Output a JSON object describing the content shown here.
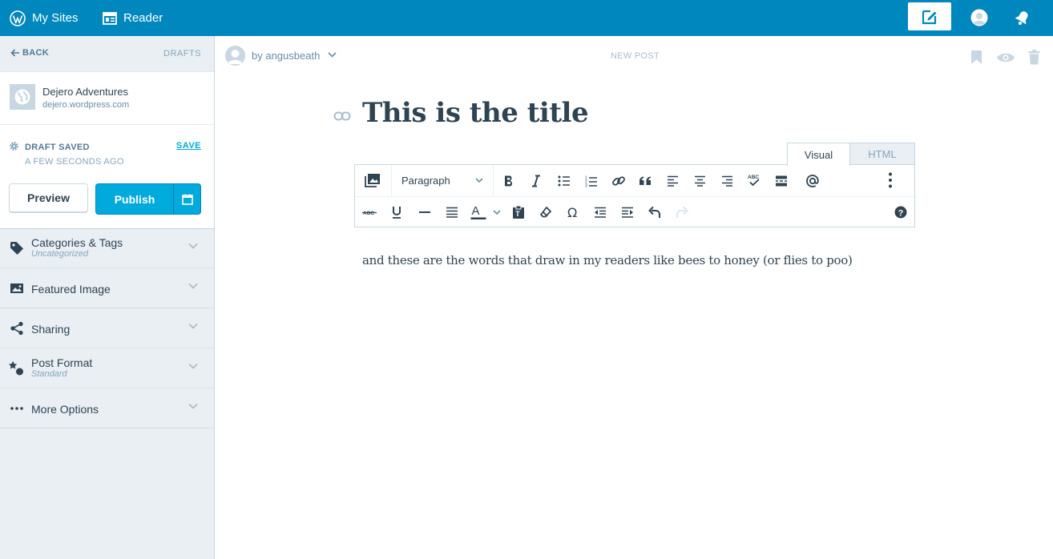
{
  "masterbar": {
    "my_sites": "My Sites",
    "reader": "Reader",
    "icons": [
      "wordpress-logo-icon",
      "reader-icon",
      "write-post-icon",
      "avatar-icon",
      "notifications-icon"
    ]
  },
  "sidebar": {
    "back": "BACK",
    "drafts": "DRAFTS",
    "site": {
      "title": "Dejero Adventures",
      "url": "dejero.wordpress.com"
    },
    "status": {
      "draft_saved": "DRAFT SAVED",
      "save": "SAVE",
      "time_ago": "A FEW SECONDS AGO"
    },
    "buttons": {
      "preview": "Preview",
      "publish": "Publish"
    },
    "accordions": [
      {
        "title": "Categories & Tags",
        "subtitle": "Uncategorized",
        "icon": "tag-icon"
      },
      {
        "title": "Featured Image",
        "subtitle": "",
        "icon": "image-icon"
      },
      {
        "title": "Sharing",
        "subtitle": "",
        "icon": "share-icon"
      },
      {
        "title": "Post Format",
        "subtitle": "Standard",
        "icon": "post-format-icon"
      },
      {
        "title": "More Options",
        "subtitle": "",
        "icon": "ellipsis-icon"
      }
    ]
  },
  "editor": {
    "author": "by angusbeath",
    "status_label": "NEW POST",
    "title": "This is the title",
    "tabs": {
      "visual": "Visual",
      "html": "HTML",
      "active": "visual"
    },
    "format_select": "Paragraph",
    "body": "and these are the words that draw in my readers like bees to honey (or flies to poo)"
  },
  "colors": {
    "masterbar": "#0087be",
    "accent": "#00aadc",
    "sidebar_bg": "#e9eff3",
    "text": "#2e4453",
    "muted": "#87a6bc"
  }
}
